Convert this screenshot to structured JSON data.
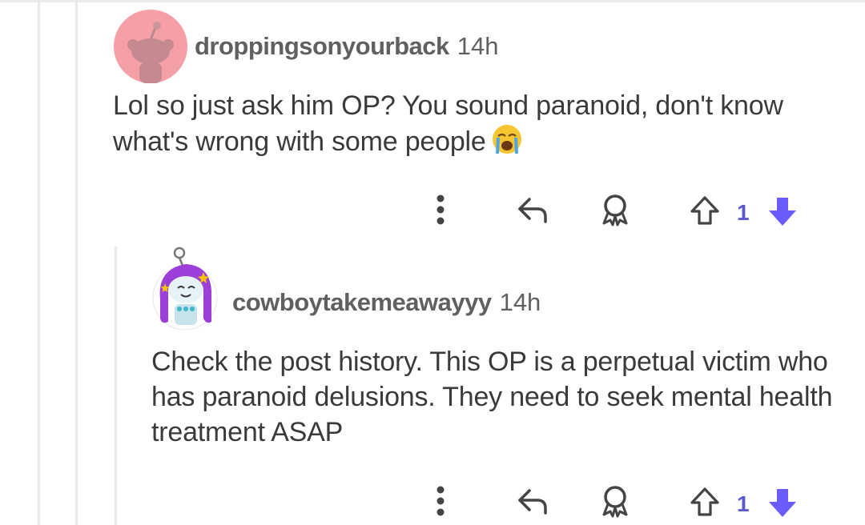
{
  "comments": [
    {
      "username": "droppingsonyourback",
      "time": "14h",
      "text": "Lol so just ask him OP? You sound paranoid, don't know what's wrong with some people",
      "emoji": "loudly-crying-face",
      "score": "1",
      "vote_state": "downvoted"
    },
    {
      "username": "cowboytakemeawayyy",
      "time": "14h",
      "text": "Check the post history. This OP is a perpetual victim who has paranoid delusions. They need to seek mental health treatment ASAP",
      "score": "1",
      "vote_state": "downvoted"
    }
  ],
  "icons": {
    "more": "more-vertical-icon",
    "reply": "reply-icon",
    "award": "award-icon",
    "upvote": "upvote-icon",
    "downvote": "downvote-icon"
  },
  "colors": {
    "downvote": "#6a5cff",
    "score": "#5a5acd",
    "avatar1_bg": "#f4a0a6",
    "avatar2_hair": "#9b3fd8"
  }
}
